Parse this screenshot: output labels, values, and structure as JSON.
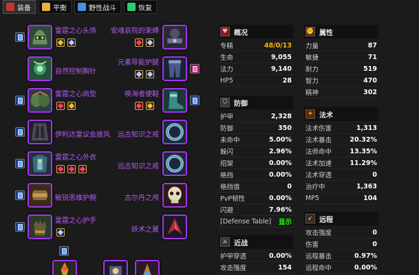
{
  "tabs": [
    {
      "label": "装备",
      "icon": "equipment-icon",
      "color": "#c0392b",
      "active": true
    },
    {
      "label": "平衡",
      "icon": "balance-icon",
      "color": "#e6b040",
      "active": false
    },
    {
      "label": "野性战斗",
      "icon": "feral-icon",
      "color": "#4a90e2",
      "active": false
    },
    {
      "label": "恢复",
      "icon": "restoration-icon",
      "color": "#2ecc71",
      "active": false
    }
  ],
  "gear_left": [
    {
      "name": "雷霆之心头饰",
      "icon": "helm-icon"
    },
    {
      "name": "自然控制胸针",
      "icon": "neck-icon"
    },
    {
      "name": "雷霆之心肩垫",
      "icon": "shoulder-icon"
    },
    {
      "name": "伊利达雷议会披风",
      "icon": "cloak-icon"
    },
    {
      "name": "雷霆之心外衣",
      "icon": "chest-icon"
    },
    {
      "name": "敏锐思维护腕",
      "icon": "bracer-icon"
    },
    {
      "name": "雷霆之心护手",
      "icon": "gloves-icon"
    }
  ],
  "gear_right": [
    {
      "name": "安魂哀院的束缚",
      "icon": "belt-icon"
    },
    {
      "name": "元素导能护腿",
      "icon": "legs-icon"
    },
    {
      "name": "唤海者便鞋",
      "icon": "boots-icon"
    },
    {
      "name": "远古知识之戒",
      "icon": "ring-icon"
    },
    {
      "name": "远古知识之戒",
      "icon": "ring-icon"
    },
    {
      "name": "古尔丹之颅",
      "icon": "skull-trinket-icon"
    },
    {
      "name": "妖术之翼",
      "icon": "wing-trinket-icon"
    }
  ],
  "panels": {
    "general": {
      "title": "概况",
      "rows": [
        {
          "label": "专精",
          "value": "48/0/13"
        },
        {
          "label": "生命",
          "value": "9,055"
        },
        {
          "label": "法力",
          "value": "9,140"
        },
        {
          "label": "HP5",
          "value": "28"
        }
      ]
    },
    "attributes": {
      "title": "属性",
      "rows": [
        {
          "label": "力量",
          "value": "87"
        },
        {
          "label": "敏捷",
          "value": "71"
        },
        {
          "label": "耐力",
          "value": "519"
        },
        {
          "label": "智力",
          "value": "470"
        },
        {
          "label": "精神",
          "value": "302"
        }
      ]
    },
    "defense": {
      "title": "防御",
      "rows": [
        {
          "label": "护甲",
          "value": "2,328"
        },
        {
          "label": "防御",
          "value": "350"
        },
        {
          "label": "未命中",
          "value": "5.00%"
        },
        {
          "label": "躲闪",
          "value": "2.96%"
        },
        {
          "label": "招架",
          "value": "0.00%"
        },
        {
          "label": "格挡",
          "value": "0.00%"
        },
        {
          "label": "格挡值",
          "value": "0"
        },
        {
          "label": "PvP韧性",
          "value": "0.00%"
        },
        {
          "label": "闪避",
          "value": "7.96%"
        },
        {
          "label": "[Defense Table]",
          "value": "显示"
        }
      ]
    },
    "spell": {
      "title": "法术",
      "rows": [
        {
          "label": "法术伤害",
          "value": "1,313"
        },
        {
          "label": "法术暴击",
          "value": "20.32%"
        },
        {
          "label": "法师命中",
          "value": "13.35%"
        },
        {
          "label": "法术加速",
          "value": "11.29%"
        },
        {
          "label": "法术穿透",
          "value": "0"
        },
        {
          "label": "治疗中",
          "value": "1,363"
        },
        {
          "label": "MP5",
          "value": "104"
        }
      ]
    },
    "melee": {
      "title": "近战",
      "rows": [
        {
          "label": "护甲穿透",
          "value": "0.00%"
        },
        {
          "label": "攻击强度",
          "value": "154"
        }
      ]
    },
    "ranged": {
      "title": "远程",
      "rows": [
        {
          "label": "攻击强度",
          "value": "0"
        },
        {
          "label": "伤害",
          "value": "0"
        },
        {
          "label": "远程暴击",
          "value": "0.97%"
        },
        {
          "label": "远程命中",
          "value": "0.00%"
        }
      ]
    }
  },
  "colors": {
    "epic": "#a335ee",
    "gold": "#f8b700",
    "green": "#1eff00"
  }
}
